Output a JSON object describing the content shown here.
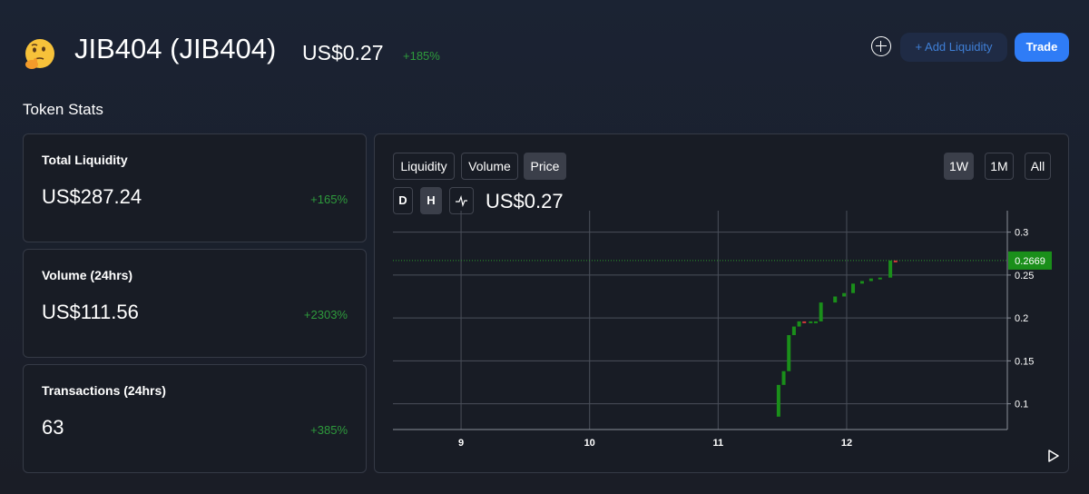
{
  "header": {
    "token_name": "JIB404 (JIB404)",
    "price": "US$0.27",
    "change": "+185%",
    "add_liquidity_label": "+ Add Liquidity",
    "trade_label": "Trade",
    "avatar_icon": "thinking-face-emoji"
  },
  "stats": {
    "title": "Token Stats",
    "cards": [
      {
        "label": "Total Liquidity",
        "value": "US$287.24",
        "change": "+165%"
      },
      {
        "label": "Volume (24hrs)",
        "value": "US$111.56",
        "change": "+2303%"
      },
      {
        "label": "Transactions (24hrs)",
        "value": "63",
        "change": "+385%"
      }
    ]
  },
  "chart_panel": {
    "tabs": [
      "Liquidity",
      "Volume",
      "Price"
    ],
    "active_tab": "Price",
    "ranges": [
      "1W",
      "1M",
      "All"
    ],
    "active_range": "1W",
    "interval_buttons": [
      "D",
      "H"
    ],
    "active_interval": "H",
    "current_price": "US$0.27"
  },
  "colors": {
    "up": "#1a8f1a",
    "down": "#d23a3a",
    "accent": "#2f7cf6",
    "change_green": "#2e9a3c"
  },
  "chart_data": {
    "type": "candlestick",
    "x_ticks": [
      "9",
      "10",
      "11",
      "12"
    ],
    "y_ticks": [
      "0.3",
      "0.25",
      "0.2",
      "0.15",
      "0.1"
    ],
    "ylim": [
      0.07,
      0.325
    ],
    "xlim": [
      8.47,
      13.25
    ],
    "last_price_label": "0.2669",
    "last_price": 0.2669,
    "grid": true,
    "candles": [
      {
        "t": 11.47,
        "o": 0.085,
        "c": 0.122
      },
      {
        "t": 11.51,
        "o": 0.122,
        "c": 0.138
      },
      {
        "t": 11.55,
        "o": 0.138,
        "c": 0.18
      },
      {
        "t": 11.59,
        "o": 0.18,
        "c": 0.19
      },
      {
        "t": 11.63,
        "o": 0.19,
        "c": 0.196
      },
      {
        "t": 11.67,
        "o": 0.196,
        "c": 0.195
      },
      {
        "t": 11.72,
        "o": 0.195,
        "c": 0.196
      },
      {
        "t": 11.76,
        "o": 0.196,
        "c": 0.196
      },
      {
        "t": 11.8,
        "o": 0.196,
        "c": 0.218
      },
      {
        "t": 11.91,
        "o": 0.218,
        "c": 0.225
      },
      {
        "t": 11.98,
        "o": 0.225,
        "c": 0.229
      },
      {
        "t": 12.05,
        "o": 0.229,
        "c": 0.24
      },
      {
        "t": 12.12,
        "o": 0.24,
        "c": 0.243
      },
      {
        "t": 12.19,
        "o": 0.243,
        "c": 0.246
      },
      {
        "t": 12.26,
        "o": 0.246,
        "c": 0.247
      },
      {
        "t": 12.34,
        "o": 0.247,
        "c": 0.2669
      },
      {
        "t": 12.38,
        "o": 0.2669,
        "c": 0.2661
      }
    ]
  }
}
